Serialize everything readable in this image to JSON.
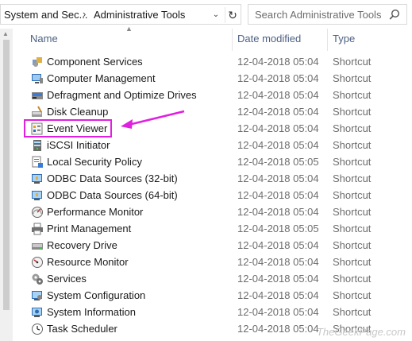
{
  "address": {
    "crumbs": [
      "System and Sec...",
      "Administrative Tools"
    ],
    "separator": "›",
    "dropdown_icon": "chevron-down-icon",
    "refresh_icon": "refresh-icon"
  },
  "search": {
    "placeholder": "Search Administrative Tools",
    "icon": "search-icon"
  },
  "columns": {
    "name": "Name",
    "date": "Date modified",
    "type": "Type"
  },
  "rows": [
    {
      "name": "Component Services",
      "date": "12-04-2018 05:04",
      "type": "Shortcut",
      "icon": "component-services-icon"
    },
    {
      "name": "Computer Management",
      "date": "12-04-2018 05:04",
      "type": "Shortcut",
      "icon": "computer-management-icon"
    },
    {
      "name": "Defragment and Optimize Drives",
      "date": "12-04-2018 05:04",
      "type": "Shortcut",
      "icon": "defragment-icon"
    },
    {
      "name": "Disk Cleanup",
      "date": "12-04-2018 05:04",
      "type": "Shortcut",
      "icon": "disk-cleanup-icon"
    },
    {
      "name": "Event Viewer",
      "date": "12-04-2018 05:04",
      "type": "Shortcut",
      "icon": "event-viewer-icon"
    },
    {
      "name": "iSCSI Initiator",
      "date": "12-04-2018 05:04",
      "type": "Shortcut",
      "icon": "iscsi-icon"
    },
    {
      "name": "Local Security Policy",
      "date": "12-04-2018 05:05",
      "type": "Shortcut",
      "icon": "security-policy-icon"
    },
    {
      "name": "ODBC Data Sources (32-bit)",
      "date": "12-04-2018 05:04",
      "type": "Shortcut",
      "icon": "odbc-icon"
    },
    {
      "name": "ODBC Data Sources (64-bit)",
      "date": "12-04-2018 05:04",
      "type": "Shortcut",
      "icon": "odbc-icon"
    },
    {
      "name": "Performance Monitor",
      "date": "12-04-2018 05:04",
      "type": "Shortcut",
      "icon": "performance-monitor-icon"
    },
    {
      "name": "Print Management",
      "date": "12-04-2018 05:05",
      "type": "Shortcut",
      "icon": "print-management-icon"
    },
    {
      "name": "Recovery Drive",
      "date": "12-04-2018 05:04",
      "type": "Shortcut",
      "icon": "recovery-drive-icon"
    },
    {
      "name": "Resource Monitor",
      "date": "12-04-2018 05:04",
      "type": "Shortcut",
      "icon": "resource-monitor-icon"
    },
    {
      "name": "Services",
      "date": "12-04-2018 05:04",
      "type": "Shortcut",
      "icon": "services-icon"
    },
    {
      "name": "System Configuration",
      "date": "12-04-2018 05:04",
      "type": "Shortcut",
      "icon": "system-configuration-icon"
    },
    {
      "name": "System Information",
      "date": "12-04-2018 05:04",
      "type": "Shortcut",
      "icon": "system-information-icon"
    },
    {
      "name": "Task Scheduler",
      "date": "12-04-2018 05:04",
      "type": "Shortcut",
      "icon": "task-scheduler-icon"
    }
  ],
  "annotation": {
    "highlighted_item": "Event Viewer",
    "color": "#e020e0"
  },
  "watermark": "TheGeekPage.com",
  "colors": {
    "header_text": "#4d6082",
    "meta_text": "#6d6d6d",
    "highlight": "#e020e0"
  }
}
